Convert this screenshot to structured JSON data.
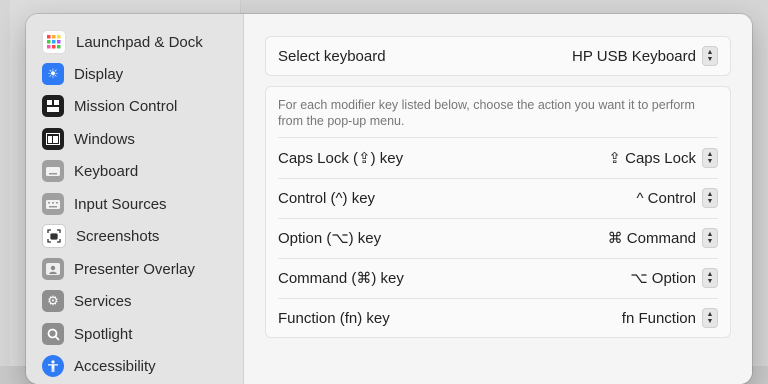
{
  "sidebar": {
    "items": [
      {
        "label": "Launchpad & Dock",
        "icon": "launchpad-icon",
        "color": "#ffffff"
      },
      {
        "label": "Display",
        "icon": "display-icon",
        "color": "#2f7bf6"
      },
      {
        "label": "Mission Control",
        "icon": "mission-control-icon",
        "color": "#1f1f1f"
      },
      {
        "label": "Windows",
        "icon": "windows-icon",
        "color": "#1f1f1f"
      },
      {
        "label": "Keyboard",
        "icon": "keyboard-icon",
        "color": "#9a9a9a"
      },
      {
        "label": "Input Sources",
        "icon": "input-sources-icon",
        "color": "#9a9a9a"
      },
      {
        "label": "Screenshots",
        "icon": "screenshots-icon",
        "color": "#ffffff"
      },
      {
        "label": "Presenter Overlay",
        "icon": "presenter-overlay-icon",
        "color": "#9a9a9a"
      },
      {
        "label": "Services",
        "icon": "services-icon",
        "color": "#8e8e8e"
      },
      {
        "label": "Spotlight",
        "icon": "spotlight-icon",
        "color": "#8e8e8e"
      },
      {
        "label": "Accessibility",
        "icon": "accessibility-icon",
        "color": "#2f7bf6"
      }
    ]
  },
  "keyboard_select": {
    "label": "Select keyboard",
    "value": "HP USB Keyboard"
  },
  "modifier": {
    "description": "For each modifier key listed below, choose the action you want it to perform from the pop-up menu.",
    "rows": [
      {
        "label": "Caps Lock (⇪) key",
        "value": "⇪ Caps Lock"
      },
      {
        "label": "Control (^) key",
        "value": "^ Control"
      },
      {
        "label": "Option (⌥) key",
        "value": "⌘ Command"
      },
      {
        "label": "Command (⌘) key",
        "value": "⌥ Option"
      },
      {
        "label": "Function (fn) key",
        "value": "fn Function"
      }
    ]
  }
}
